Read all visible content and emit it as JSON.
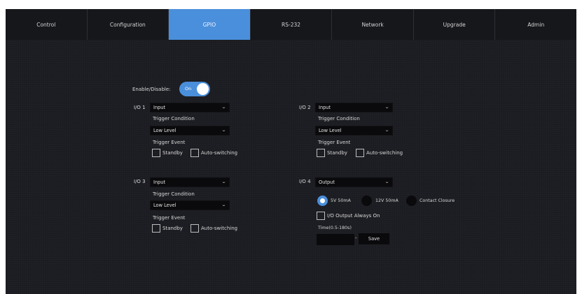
{
  "tabs": [
    "Control",
    "Configuration",
    "GPIO",
    "RS-232",
    "Network",
    "Upgrade",
    "Admin"
  ],
  "active_tab": "GPIO",
  "accent_color": "#4a8fdb",
  "enable": {
    "label": "Enable/Disable:",
    "toggle_text": "On",
    "state": "on"
  },
  "io1": {
    "label": "I/O 1",
    "mode": "Input",
    "trigger_condition_label": "Trigger Condition",
    "trigger_condition": "Low Level",
    "trigger_event_label": "Trigger Event",
    "standby_label": "Standby",
    "auto_switching_label": "Auto-switching"
  },
  "io2": {
    "label": "I/O 2",
    "mode": "Input",
    "trigger_condition_label": "Trigger Condition",
    "trigger_condition": "Low Level",
    "trigger_event_label": "Trigger Event",
    "standby_label": "Standby",
    "auto_switching_label": "Auto-switching"
  },
  "io3": {
    "label": "I/O 3",
    "mode": "Input",
    "trigger_condition_label": "Trigger Condition",
    "trigger_condition": "Low Level",
    "trigger_event_label": "Trigger Event",
    "standby_label": "Standby",
    "auto_switching_label": "Auto-switching"
  },
  "io4": {
    "label": "I/O 4",
    "mode": "Output",
    "options": [
      "5V 50mA",
      "12V 50mA",
      "Contact Closure"
    ],
    "selected_option": "5V 50mA",
    "always_on_label": "I/O Output Always On",
    "time_label": "Time(0.5-180s)",
    "time_value": "",
    "separator": "-",
    "save_label": "Save"
  }
}
